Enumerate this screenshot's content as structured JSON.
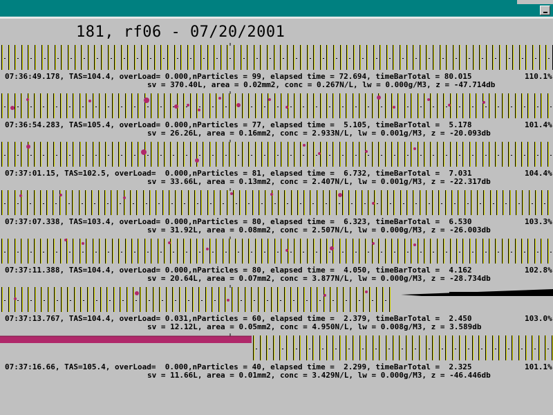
{
  "window": {
    "title_bar_color": "#008080"
  },
  "page": {
    "title": "181, rf06 - 07/20/2001"
  },
  "colors": {
    "tick": "#000000",
    "baseline": "#d8d800",
    "particle": "#b0286a",
    "overload_black": "#000000"
  },
  "records": [
    {
      "line1": "07:36:49.178, TAS=104.4, overLoad= 0.000,nParticles = 99, elapsed time = 72.694, timeBarTotal = 80.015",
      "line2": "sv = 370.40L, area = 0.02mm2, conc = 0.267N/L, lw = 0.000g/M3, z = -47.714db",
      "percent": "110.1%"
    },
    {
      "line1": "07:36:54.283, TAS=105.4, overLoad= 0.000,nParticles = 77, elapsed time =  5.105, timeBarTotal =  5.178",
      "line2": "sv = 26.26L, area = 0.16mm2, conc = 2.933N/L, lw = 0.001g/M3, z = -20.093db",
      "percent": "101.4%"
    },
    {
      "line1": "07:37:01.15, TAS=102.5, overLoad=  0.000,nParticles = 81, elapsed time =  6.732, timeBarTotal =  7.031",
      "line2": "sv = 33.66L, area = 0.13mm2, conc = 2.407N/L, lw = 0.001g/M3, z = -22.317db",
      "percent": "104.4%"
    },
    {
      "line1": "07:37:07.338, TAS=103.4, overLoad= 0.000,nParticles = 80, elapsed time =  6.323, timeBarTotal =  6.530",
      "line2": "sv = 31.92L, area = 0.08mm2, conc = 2.507N/L, lw = 0.000g/M3, z = -26.003db",
      "percent": "103.3%"
    },
    {
      "line1": "07:37:11.388, TAS=104.4, overLoad= 0.000,nParticles = 80, elapsed time =  4.050, timeBarTotal =  4.162",
      "line2": "sv = 20.64L, area = 0.07mm2, conc = 3.877N/L, lw = 0.000g/M3, z = -28.734db",
      "percent": "102.8%"
    },
    {
      "line1": "07:37:13.767, TAS=104.4, overLoad= 0.031,nParticles = 60, elapsed time =  2.379, timeBarTotal =  2.450",
      "line2": "sv = 12.12L, area = 0.05mm2, conc = 4.950N/L, lw = 0.008g/M3, z = 3.589db",
      "percent": "103.0%"
    },
    {
      "line1": "07:37:16.66, TAS=105.4, overLoad=  0.000,nParticles = 40, elapsed time =  2.299, timeBarTotal =  2.325",
      "line2": "sv = 11.66L, area = 0.01mm2, conc = 3.429N/L, lw = 0.000g/M3, z = -46.446db",
      "percent": "101.1%"
    }
  ]
}
